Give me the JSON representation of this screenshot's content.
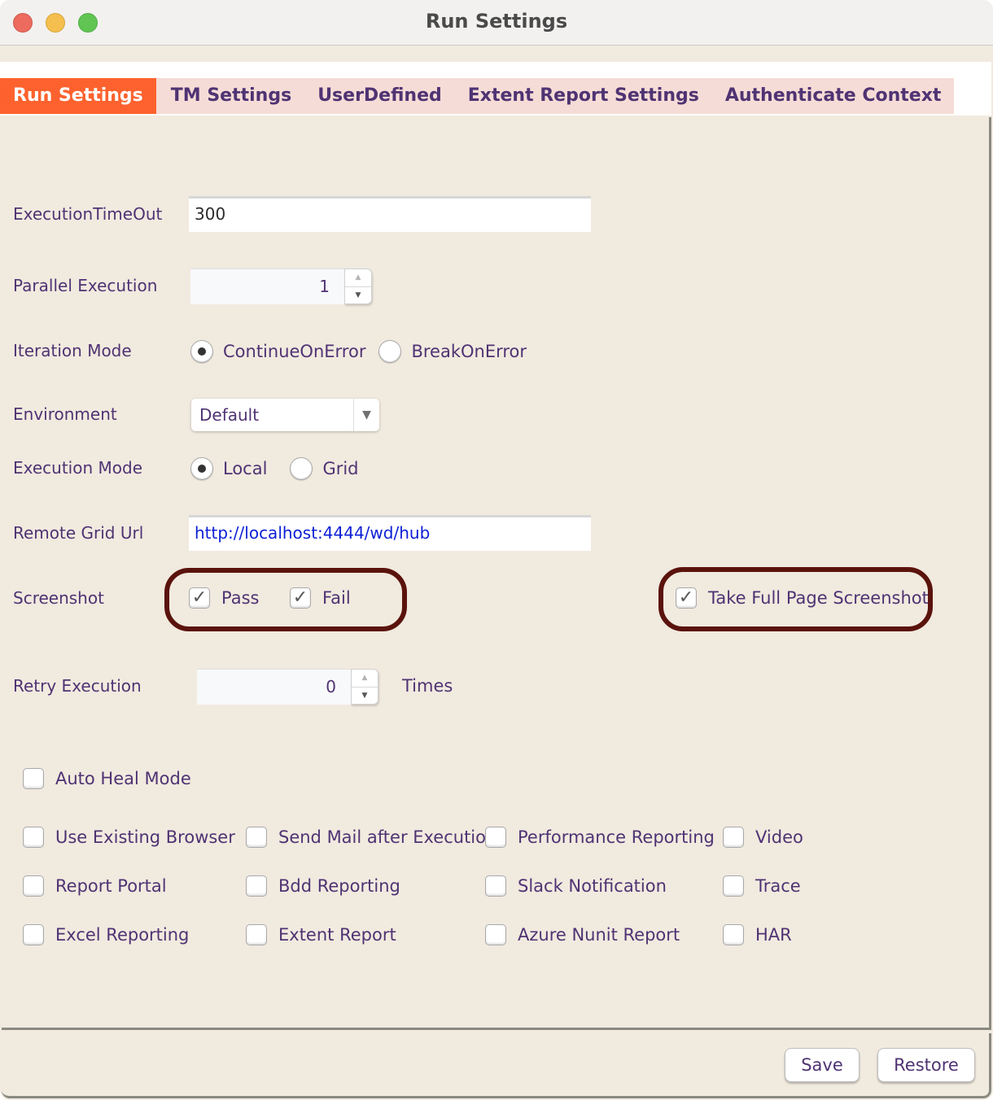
{
  "window": {
    "title": "Run Settings",
    "controls": [
      "close",
      "minimize",
      "maximize"
    ]
  },
  "tabs": [
    {
      "label": "Run Settings",
      "active": true
    },
    {
      "label": "TM Settings",
      "active": false
    },
    {
      "label": "UserDefined",
      "active": false
    },
    {
      "label": "Extent Report Settings",
      "active": false
    },
    {
      "label": "Authenticate Context",
      "active": false
    }
  ],
  "form": {
    "execution_timeout": {
      "label": "ExecutionTimeOut",
      "value": "300"
    },
    "parallel_execution": {
      "label": "Parallel Execution",
      "value": "1",
      "up_icon": "▲",
      "down_icon": "▼"
    },
    "iteration_mode": {
      "label": "Iteration Mode",
      "options": [
        {
          "label": "ContinueOnError",
          "selected": true
        },
        {
          "label": "BreakOnError",
          "selected": false
        }
      ]
    },
    "environment": {
      "label": "Environment",
      "value": "Default",
      "arrow_icon": "▼"
    },
    "execution_mode": {
      "label": "Execution Mode",
      "options": [
        {
          "label": "Local",
          "selected": true
        },
        {
          "label": "Grid",
          "selected": false
        }
      ]
    },
    "remote_grid_url": {
      "label": "Remote Grid Url",
      "value": "http://localhost:4444/wd/hub"
    },
    "screenshot": {
      "label": "Screenshot",
      "pass": {
        "label": "Pass",
        "checked": true
      },
      "fail": {
        "label": "Fail",
        "checked": true
      },
      "full_page": {
        "label": "Take Full Page Screenshot",
        "checked": true
      },
      "check_glyph": "✓"
    },
    "retry_execution": {
      "label": "Retry Execution",
      "value": "0",
      "suffix": "Times",
      "up_icon": "▲",
      "down_icon": "▼"
    },
    "auto_heal_mode": {
      "label": "Auto Heal Mode",
      "checked": false
    }
  },
  "options_grid": [
    [
      {
        "label": "Use Existing Browser",
        "checked": false
      },
      {
        "label": "Send Mail after Execution",
        "checked": false
      },
      {
        "label": "Performance Reporting",
        "checked": false
      },
      {
        "label": "Video",
        "checked": false
      }
    ],
    [
      {
        "label": "Report Portal",
        "checked": false
      },
      {
        "label": "Bdd Reporting",
        "checked": false
      },
      {
        "label": "Slack Notification",
        "checked": false
      },
      {
        "label": "Trace",
        "checked": false
      }
    ],
    [
      {
        "label": "Excel Reporting",
        "checked": false
      },
      {
        "label": "Extent Report",
        "checked": false
      },
      {
        "label": "Azure Nunit Report",
        "checked": false
      },
      {
        "label": "HAR",
        "checked": false
      }
    ]
  ],
  "footer": {
    "save_label": "Save",
    "restore_label": "Restore"
  },
  "colors": {
    "active_tab": "#fd622e",
    "tab_bg": "#f6dcd6",
    "label_text": "#4f3373",
    "highlight_outline": "#5a130c",
    "url_text": "#0b1fd6",
    "panel_bg": "#f1eadf"
  }
}
